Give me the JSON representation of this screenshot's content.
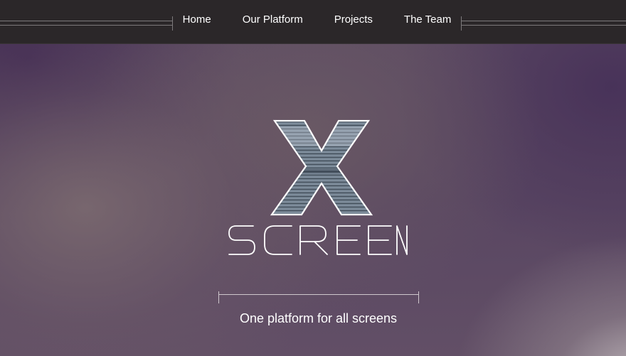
{
  "nav": {
    "items": [
      {
        "label": "Home"
      },
      {
        "label": "Our Platform"
      },
      {
        "label": "Projects"
      },
      {
        "label": "The Team"
      }
    ]
  },
  "hero": {
    "logo_mark": "X",
    "logo_word": "SCREEN",
    "tagline": "One platform for all screens"
  },
  "colors": {
    "navbar_bg": "#2b2729",
    "hero_purple": "#5c4a63",
    "text": "#ffffff"
  }
}
